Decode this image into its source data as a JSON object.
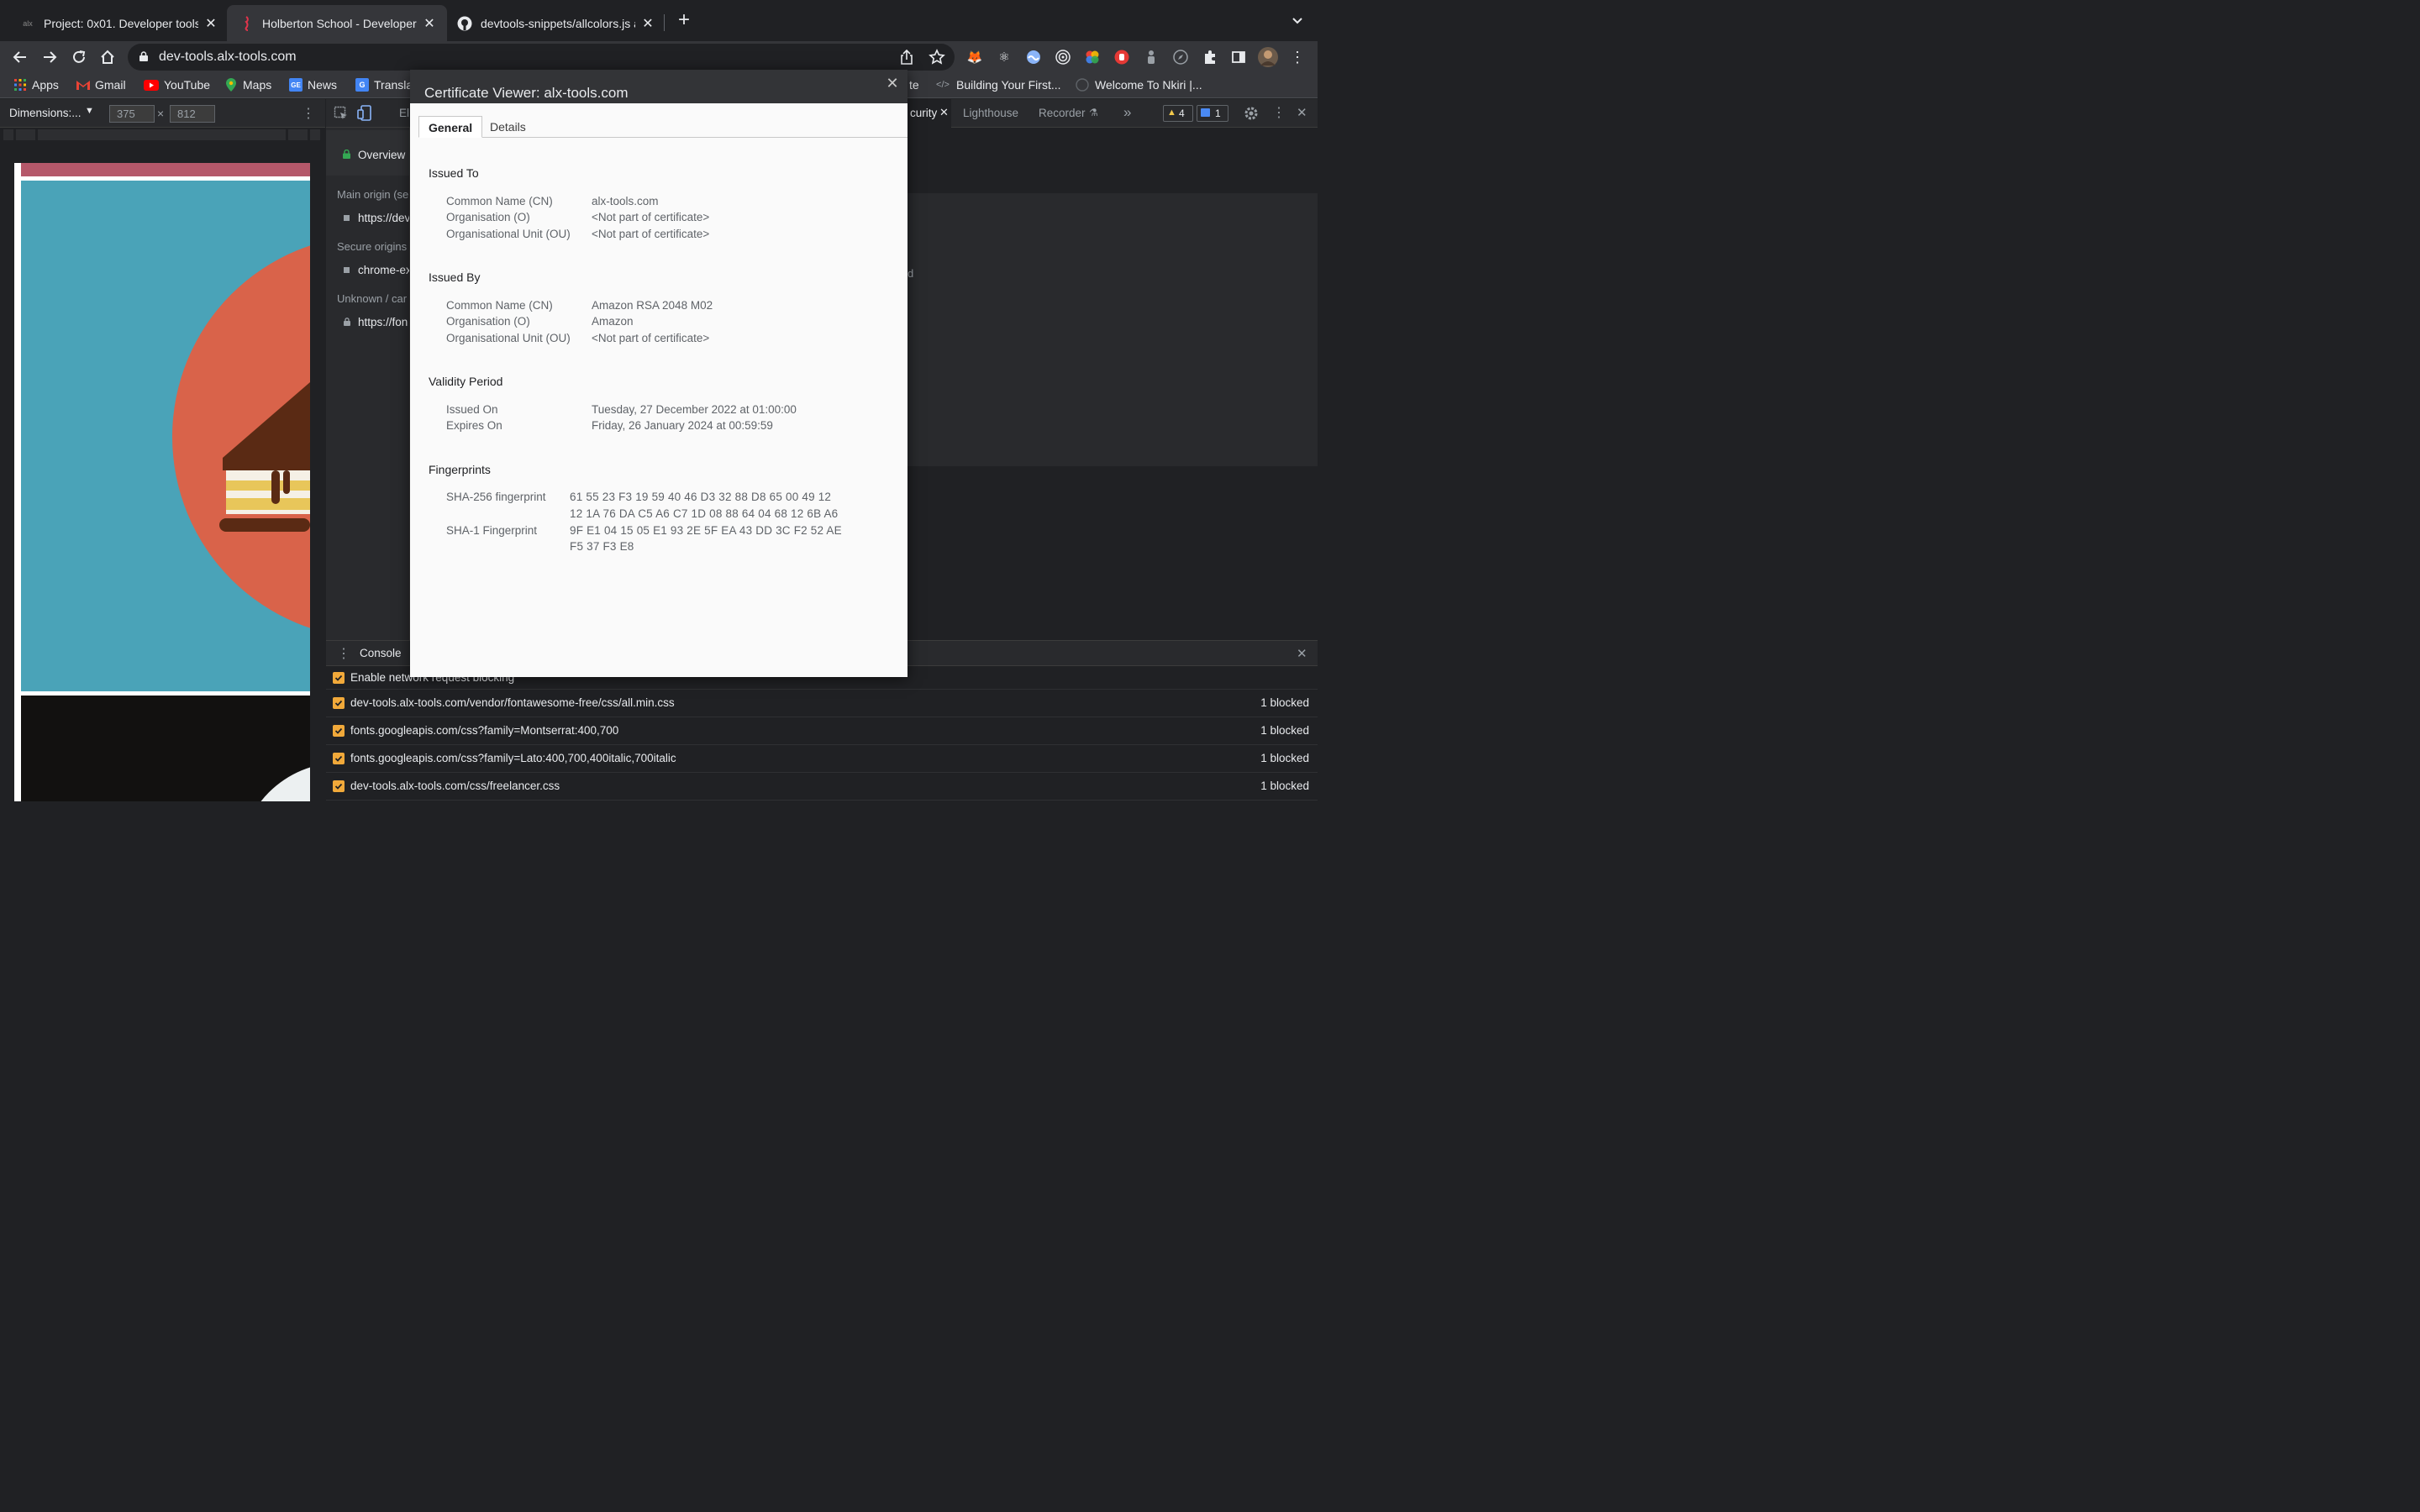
{
  "browser": {
    "tabs": [
      {
        "title": "Project: 0x01. Developer tools",
        "favicon": "alx-icon",
        "active": false
      },
      {
        "title": "Holberton School - Developer t",
        "favicon": "holberton-seahorse-icon",
        "active": true
      },
      {
        "title": "devtools-snippets/allcolors.js a",
        "favicon": "github-icon",
        "active": false
      }
    ],
    "new_tab": "+",
    "url": "dev-tools.alx-tools.com",
    "bookmarks": [
      {
        "label": "Apps",
        "icon": "apps-grid-icon"
      },
      {
        "label": "Gmail",
        "icon": "gmail-icon"
      },
      {
        "label": "YouTube",
        "icon": "youtube-icon"
      },
      {
        "label": "Maps",
        "icon": "maps-icon"
      },
      {
        "label": "News",
        "icon": "news-icon"
      },
      {
        "label": "Transla",
        "icon": "translate-icon"
      },
      {
        "label": "te",
        "icon": ""
      },
      {
        "label": "Building Your First...",
        "icon": "code-icon"
      },
      {
        "label": "Welcome To Nkiri |...",
        "icon": "globe-icon"
      }
    ]
  },
  "device_toolbar": {
    "dimensions_label": "Dimensions:...",
    "width": "375",
    "times": "×",
    "height": "812"
  },
  "devtools": {
    "tabs": {
      "elements_partial": "El",
      "security_partial": "curity",
      "lighthouse": "Lighthouse",
      "recorder": "Recorder",
      "more": "»",
      "warnings_count": "4",
      "messages_count": "1"
    },
    "security_panel": {
      "overview": "Overview",
      "main_origin": "Main origin (se",
      "main_origin_url": "https://dev",
      "secure_origins": "Secure origins",
      "secure_origin_url": "chrome-ex",
      "unknown": "Unknown / car",
      "unknown_url": "https://fon",
      "right_fragment": "d"
    },
    "drawer": {
      "tab": "Console",
      "enable_label": "Enable network request blocking",
      "rows": [
        {
          "pattern": "dev-tools.alx-tools.com/vendor/fontawesome-free/css/all.min.css",
          "count": "1 blocked"
        },
        {
          "pattern": "fonts.googleapis.com/css?family=Montserrat:400,700",
          "count": "1 blocked"
        },
        {
          "pattern": "fonts.googleapis.com/css?family=Lato:400,700,400italic,700italic",
          "count": "1 blocked"
        },
        {
          "pattern": "dev-tools.alx-tools.com/css/freelancer.css",
          "count": "1 blocked"
        }
      ]
    }
  },
  "certificate": {
    "title": "Certificate Viewer: alx-tools.com",
    "tabs": [
      "General",
      "Details"
    ],
    "issued_to": {
      "heading": "Issued To",
      "rows": [
        {
          "label": "Common Name (CN)",
          "value": "alx-tools.com"
        },
        {
          "label": "Organisation (O)",
          "value": "<Not part of certificate>"
        },
        {
          "label": "Organisational Unit (OU)",
          "value": "<Not part of certificate>"
        }
      ]
    },
    "issued_by": {
      "heading": "Issued By",
      "rows": [
        {
          "label": "Common Name (CN)",
          "value": "Amazon RSA 2048 M02"
        },
        {
          "label": "Organisation (O)",
          "value": "Amazon"
        },
        {
          "label": "Organisational Unit (OU)",
          "value": "<Not part of certificate>"
        }
      ]
    },
    "validity": {
      "heading": "Validity Period",
      "rows": [
        {
          "label": "Issued On",
          "value": "Tuesday, 27 December 2022 at 01:00:00"
        },
        {
          "label": "Expires On",
          "value": "Friday, 26 January 2024 at 00:59:59"
        }
      ]
    },
    "fingerprints": {
      "heading": "Fingerprints",
      "sha256_label": "SHA-256 fingerprint",
      "sha256_line1": "61 55 23 F3 19 59 40 46 D3 32 88 D8 65 00 49 12",
      "sha256_line2": "12 1A 76 DA C5 A6 C7 1D 08 88 64 04 68 12 6B A6",
      "sha1_label": "SHA-1 Fingerprint",
      "sha1_line1": "9F E1 04 15 05 E1 93 2E 5F EA 43 DD 3C F2 52 AE",
      "sha1_line2": "F5 37 F3 E8"
    }
  },
  "colors": {
    "accent_checkbox": "#f1a93a",
    "preview_teal": "#4aa3b8",
    "preview_coral": "#d9634a",
    "preview_header": "#b5586a"
  }
}
